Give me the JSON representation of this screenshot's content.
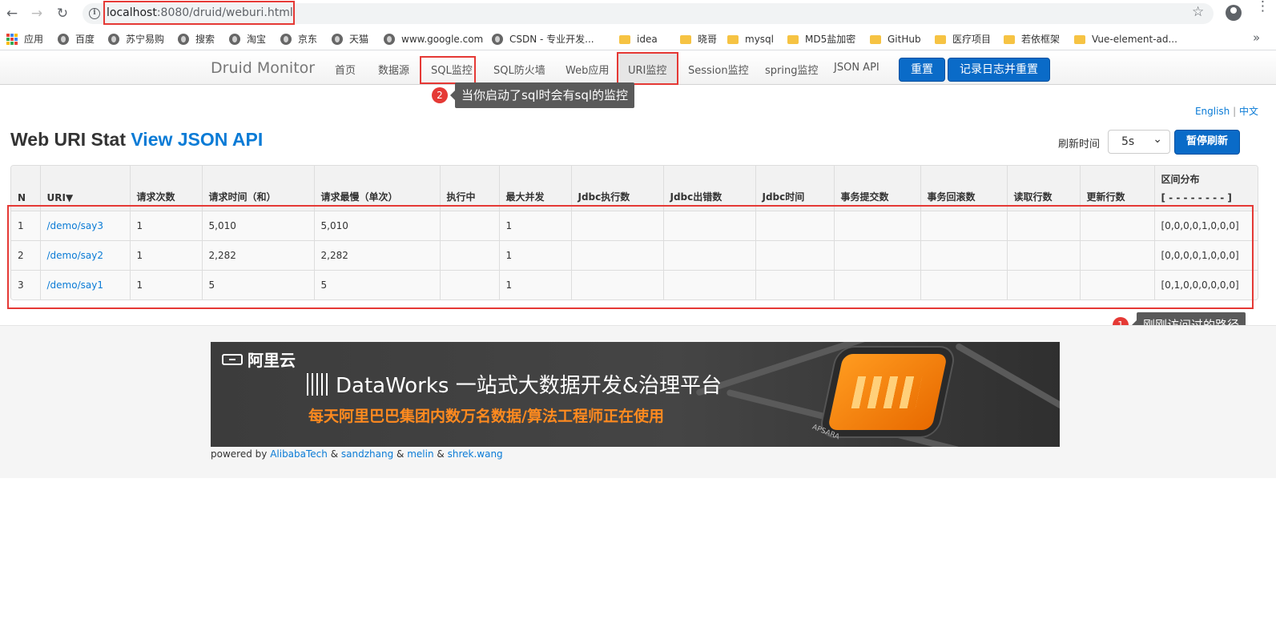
{
  "browser": {
    "url_host": "localhost",
    "url_rest": ":8080/druid/weburi.html",
    "bookmarks": [
      {
        "label": "应用",
        "type": "apps"
      },
      {
        "label": "百度",
        "type": "globe"
      },
      {
        "label": "苏宁易购",
        "type": "globe"
      },
      {
        "label": "搜索",
        "type": "globe"
      },
      {
        "label": "淘宝",
        "type": "globe"
      },
      {
        "label": "京东",
        "type": "globe"
      },
      {
        "label": "天猫",
        "type": "globe"
      },
      {
        "label": "www.google.com",
        "type": "globe"
      },
      {
        "label": "CSDN - 专业开发...",
        "type": "globe"
      },
      {
        "label": "idea",
        "type": "folder"
      },
      {
        "label": "晓哥",
        "type": "folder"
      },
      {
        "label": "mysql",
        "type": "folder"
      },
      {
        "label": "MD5盐加密",
        "type": "folder"
      },
      {
        "label": "GitHub",
        "type": "folder"
      },
      {
        "label": "医疗项目",
        "type": "folder"
      },
      {
        "label": "若依框架",
        "type": "folder"
      },
      {
        "label": "Vue-element-ad...",
        "type": "folder"
      }
    ],
    "more_label": "»"
  },
  "nav": {
    "brand": "Druid Monitor",
    "links": [
      "首页",
      "数据源",
      "SQL监控",
      "SQL防火墙",
      "Web应用",
      "URI监控",
      "Session监控",
      "spring监控",
      "JSON API"
    ],
    "reset_label": "重置",
    "log_reset_label": "记录日志并重置"
  },
  "annotations": {
    "badge1": "1",
    "tooltip1": "刚刚访问过的路径",
    "badge2": "2",
    "tooltip2": "当你启动了sql时会有sql的监控",
    "highlight_color": "#e53935"
  },
  "lang": {
    "english": "English",
    "sep": "|",
    "chinese": "中文"
  },
  "page": {
    "title_text": "Web URI Stat",
    "title_link": "View JSON API",
    "refresh_label": "刷新时间",
    "refresh_value": "5s",
    "pause_label": "暂停刷新"
  },
  "table": {
    "headers": [
      "N",
      "URI▼",
      "请求次数",
      "请求时间（和）",
      "请求最慢（单次）",
      "执行中",
      "最大并发",
      "Jdbc执行数",
      "Jdbc出错数",
      "Jdbc时间",
      "事务提交数",
      "事务回滚数",
      "读取行数",
      "更新行数",
      "区间分布"
    ],
    "dist_sub": "[ - - - - - - - - ]",
    "rows": [
      [
        "1",
        "/demo/say3",
        "1",
        "5,010",
        "5,010",
        "",
        "1",
        "",
        "",
        "",
        "",
        "",
        "",
        "",
        "[0,0,0,0,1,0,0,0]"
      ],
      [
        "2",
        "/demo/say2",
        "1",
        "2,282",
        "2,282",
        "",
        "1",
        "",
        "",
        "",
        "",
        "",
        "",
        "",
        "[0,0,0,0,1,0,0,0]"
      ],
      [
        "3",
        "/demo/say1",
        "1",
        "5",
        "5",
        "",
        "1",
        "",
        "",
        "",
        "",
        "",
        "",
        "",
        "[0,1,0,0,0,0,0,0]"
      ]
    ]
  },
  "footer": {
    "banner_brand": "阿里云",
    "banner_title": "DataWorks 一站式大数据开发&治理平台",
    "banner_sub": "每天阿里巴巴集团内数万名数据/算法工程师正在使用",
    "banner_tag": "APSARA",
    "powered_prefix": "powered by",
    "credits": [
      "AlibabaTech",
      "sandzhang",
      "melin",
      "shrek.wang"
    ],
    "amp": "&"
  },
  "colors": {
    "link": "#0a7bd6",
    "primary": "#0a6bc8",
    "banner_orange": "#ff8a1f"
  }
}
